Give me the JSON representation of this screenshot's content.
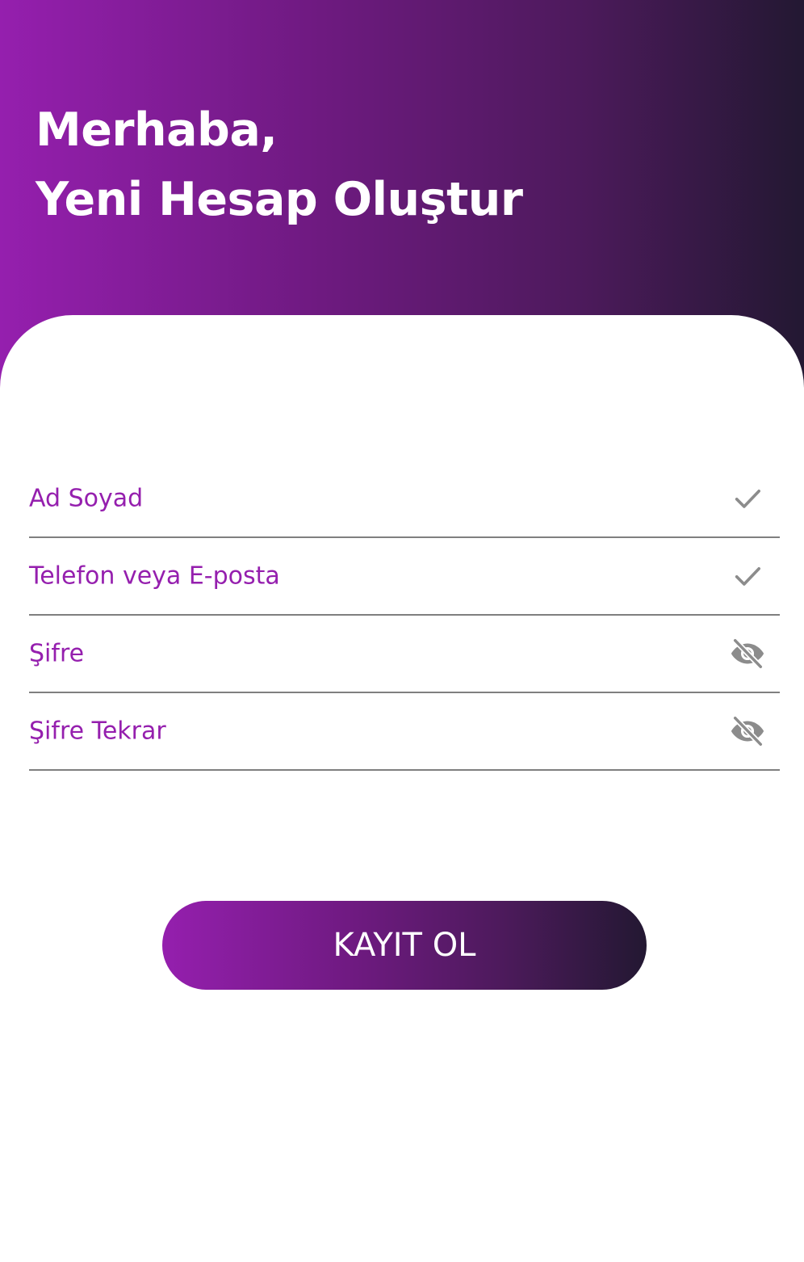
{
  "header": {
    "line1": "Merhaba,",
    "line2": "Yeni Hesap Oluştur"
  },
  "form": {
    "fields": [
      {
        "label": "Ad Soyad",
        "icon": "check-icon"
      },
      {
        "label": "Telefon veya E-posta",
        "icon": "check-icon"
      },
      {
        "label": "Şifre",
        "icon": "eye-off-icon"
      },
      {
        "label": "Şifre Tekrar",
        "icon": "eye-off-icon"
      }
    ],
    "submit_label": "KAYIT OL"
  },
  "colors": {
    "accent": "#951fae",
    "gradient_end": "#231832",
    "icon": "#8c8c8c",
    "divider": "#7f7f7f"
  }
}
